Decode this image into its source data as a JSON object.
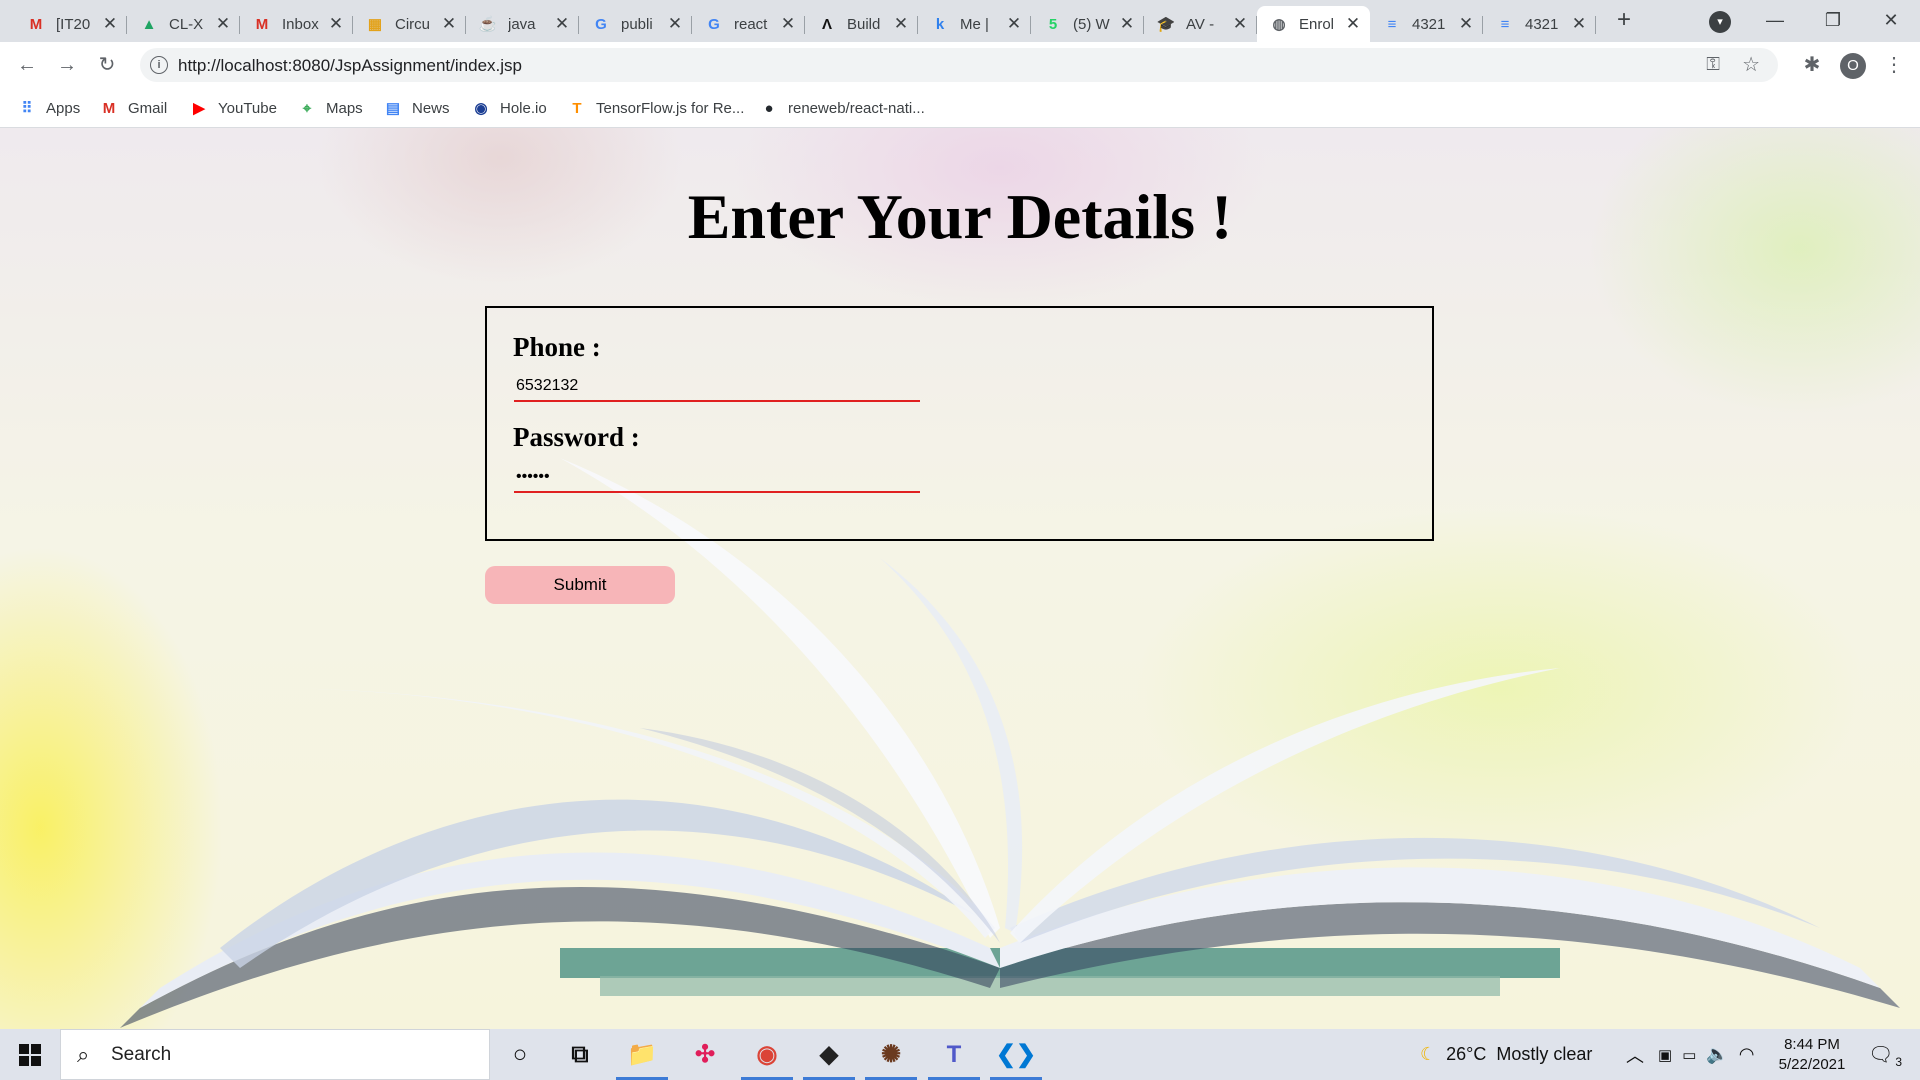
{
  "browser": {
    "tabs": [
      {
        "title": "[IT20",
        "icon": "gmail-icon",
        "color": "#d93025",
        "glyph": "M",
        "active": false
      },
      {
        "title": "CL-X",
        "icon": "google-drive-icon",
        "color": "#1fa463",
        "glyph": "▲",
        "active": false
      },
      {
        "title": "Inbox",
        "icon": "gmail-icon",
        "color": "#d93025",
        "glyph": "M",
        "active": false
      },
      {
        "title": "Circu",
        "icon": "grid-app-icon",
        "color": "#e3a21a",
        "glyph": "▦",
        "active": false
      },
      {
        "title": "java",
        "icon": "java-icon",
        "color": "#e76f00",
        "glyph": "☕",
        "active": false
      },
      {
        "title": "publi",
        "icon": "google-icon",
        "color": "#4285f4",
        "glyph": "G",
        "active": false
      },
      {
        "title": "react",
        "icon": "google-icon",
        "color": "#4285f4",
        "glyph": "G",
        "active": false
      },
      {
        "title": "Build",
        "icon": "build-icon",
        "color": "#111111",
        "glyph": "Λ",
        "active": false
      },
      {
        "title": "Me |",
        "icon": "k-icon",
        "color": "#2f80ed",
        "glyph": "k",
        "active": false
      },
      {
        "title": "(5) W",
        "icon": "whatsapp-icon",
        "color": "#25d366",
        "glyph": "5",
        "active": false
      },
      {
        "title": "AV -",
        "icon": "graduation-cap-icon",
        "color": "#555555",
        "glyph": "🎓",
        "active": false
      },
      {
        "title": "Enrol",
        "icon": "globe-icon",
        "color": "#5f6368",
        "glyph": "◍",
        "active": true
      },
      {
        "title": "4321",
        "icon": "google-docs-icon",
        "color": "#4285f4",
        "glyph": "≡",
        "active": false
      },
      {
        "title": "4321",
        "icon": "google-docs-icon",
        "color": "#4285f4",
        "glyph": "≡",
        "active": false
      }
    ],
    "new_tab_glyph": "+",
    "url": "http://localhost:8080/JspAssignment/index.jsp",
    "profile_initial": "O",
    "bookmarks": [
      {
        "label": "Apps",
        "icon": "apps-grid-icon",
        "color": "#4285f4",
        "glyph": "⠿"
      },
      {
        "label": "Gmail",
        "icon": "gmail-icon",
        "color": "#d93025",
        "glyph": "M"
      },
      {
        "label": "YouTube",
        "icon": "youtube-icon",
        "color": "#ff0000",
        "glyph": "▶"
      },
      {
        "label": "Maps",
        "icon": "maps-icon",
        "color": "#34a853",
        "glyph": "⌖"
      },
      {
        "label": "News",
        "icon": "news-icon",
        "color": "#4285f4",
        "glyph": "▤"
      },
      {
        "label": "Hole.io",
        "icon": "hole-io-icon",
        "color": "#1c3f94",
        "glyph": "◉"
      },
      {
        "label": "TensorFlow.js for Re...",
        "icon": "tensorflow-icon",
        "color": "#ff8f00",
        "glyph": "T"
      },
      {
        "label": "reneweb/react-nati...",
        "icon": "github-icon",
        "color": "#24292e",
        "glyph": "●"
      }
    ]
  },
  "page": {
    "heading": "Enter Your Details !",
    "phone_label": "Phone :",
    "phone_value": "6532132",
    "password_label": "Password :",
    "password_value": "••••••",
    "submit_label": "Submit"
  },
  "taskbar": {
    "search_placeholder": "Search",
    "apps": [
      {
        "name": "cortana-icon",
        "running": false
      },
      {
        "name": "task-view-icon",
        "running": false
      },
      {
        "name": "file-explorer-icon",
        "running": true
      },
      {
        "name": "slack-icon",
        "running": false
      },
      {
        "name": "chrome-icon",
        "running": true
      },
      {
        "name": "predator-sense-icon",
        "running": true
      },
      {
        "name": "game-app-icon",
        "running": true
      },
      {
        "name": "teams-icon",
        "running": true
      },
      {
        "name": "vscode-icon",
        "running": true
      }
    ],
    "weather": "26°C  Mostly clear",
    "time": "8:44 PM",
    "date": "5/22/2021",
    "notification_count": "3"
  },
  "colors": {
    "input_underline": "#e02020",
    "submit_background": "#f7b5b8",
    "accent": "#3d7bd6"
  }
}
